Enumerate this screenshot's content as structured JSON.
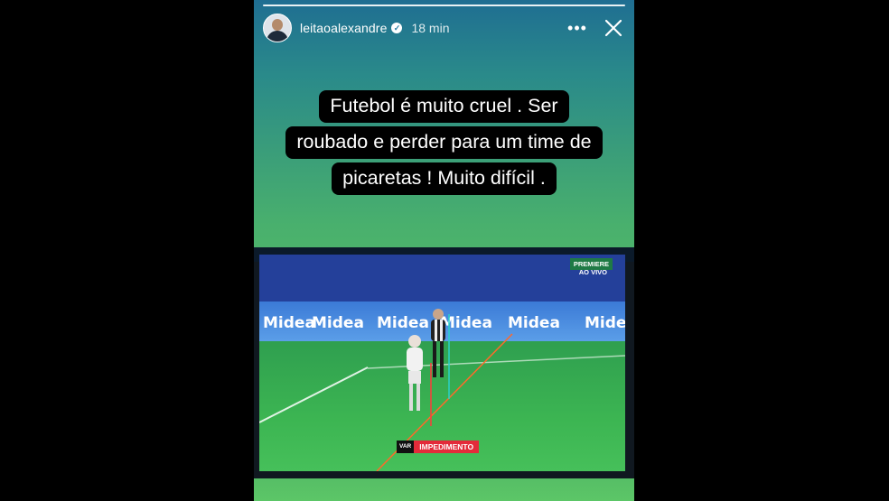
{
  "story": {
    "username": "leitaoalexandre",
    "time": "18 min",
    "menu_icon": "more-horizontal-icon",
    "close_icon": "close-icon",
    "caption_lines": [
      "Futebol é muito cruel . Ser",
      "roubado e perder para um time de",
      "picaretas ! Muito difícil ."
    ]
  },
  "tv": {
    "broadcaster": "PREMIERE",
    "live": "AO VIVO",
    "ad_text": "Midea",
    "var_tag": "VAR",
    "var_label": "IMPEDIMENTO"
  }
}
